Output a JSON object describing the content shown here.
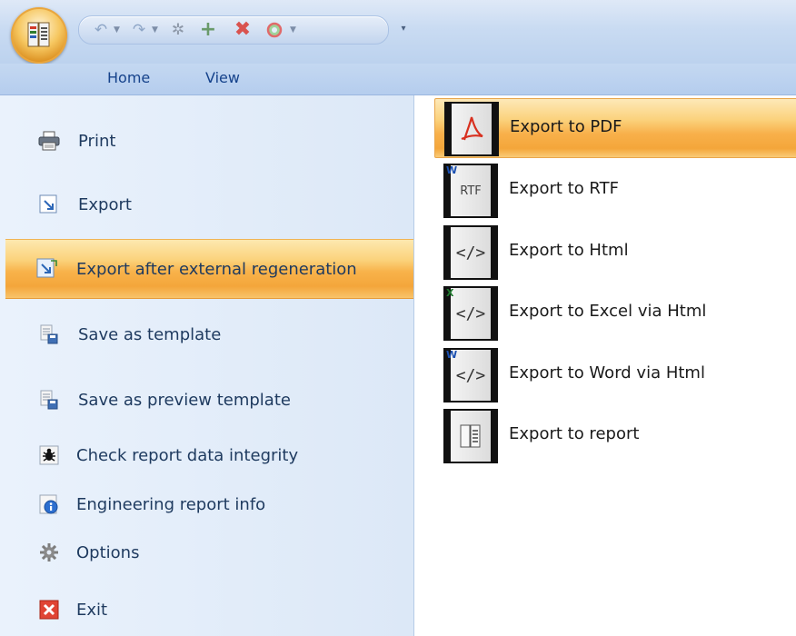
{
  "tabs": [
    "Home",
    "View"
  ],
  "qat_icons": [
    "undo-icon",
    "redo-icon",
    "settings-icon",
    "add-icon",
    "delete-icon",
    "refresh-icon"
  ],
  "menu": {
    "items": [
      {
        "label": "Print",
        "icon": "printer-icon"
      },
      {
        "label": "Export",
        "icon": "export-icon"
      },
      {
        "label": "Export after external regeneration",
        "icon": "export-regenerate-icon",
        "selected": true
      },
      {
        "label": "Save as template",
        "icon": "save-template-icon"
      },
      {
        "label": "Save as preview template",
        "icon": "save-preview-template-icon"
      },
      {
        "label": "Check report data integrity",
        "icon": "bug-icon"
      },
      {
        "label": "Engineering report info",
        "icon": "info-icon"
      },
      {
        "label": "Options",
        "icon": "gear-icon"
      },
      {
        "label": "Exit",
        "icon": "exit-icon"
      }
    ]
  },
  "submenu": {
    "items": [
      {
        "label": "Export to PDF",
        "icon": "pdf-icon",
        "selected": true
      },
      {
        "label": "Export to RTF",
        "icon": "rtf-icon",
        "icon_text": "RTF",
        "badge": "W"
      },
      {
        "label": "Export to Html",
        "icon": "html-icon",
        "icon_text": "</>"
      },
      {
        "label": "Export to Excel via Html",
        "icon": "excel-html-icon",
        "icon_text": "</>",
        "badge": "X"
      },
      {
        "label": "Export to Word via Html",
        "icon": "word-html-icon",
        "icon_text": "</>",
        "badge": "W"
      },
      {
        "label": "Export to report",
        "icon": "report-icon"
      }
    ]
  },
  "colors": {
    "highlight": "#f8b24a",
    "menu_text": "#1e3a5f",
    "tab_text": "#15428b"
  }
}
